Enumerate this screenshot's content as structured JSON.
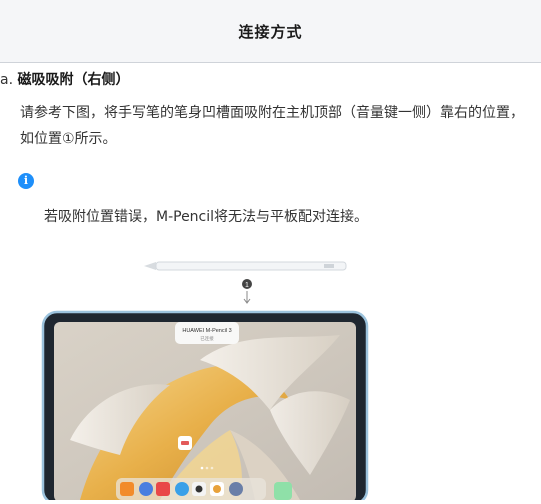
{
  "header": {
    "title": "连接方式"
  },
  "section": {
    "number": "a.",
    "title": "磁吸吸附（右侧）"
  },
  "instruction": "请参考下图，将手写笔的笔身凹槽面吸附在主机顶部（音量键一侧）靠右的位置，如位置①所示。",
  "info_icon": {
    "glyph": "i",
    "name": "info-icon"
  },
  "note": "若吸附位置错误，M-Pencil将无法与平板配对连接。",
  "figure": {
    "marker": "1",
    "popup_title": "HUAWEI M-Pencil 3",
    "popup_sub": "已连接"
  },
  "colors": {
    "info": "#1e8ffa",
    "tablet_frame": "#9cc3dd",
    "wallpaper_gold": "#e8b04a"
  }
}
